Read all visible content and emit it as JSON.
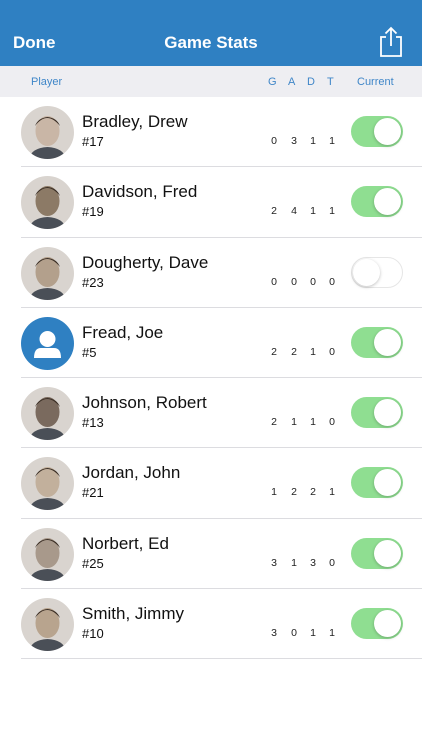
{
  "navbar": {
    "done_label": "Done",
    "title": "Game Stats",
    "share_icon": "share-icon"
  },
  "columns": {
    "player": "Player",
    "g": "G",
    "a": "A",
    "d": "D",
    "t": "T",
    "current": "Current"
  },
  "colors": {
    "nav_bg": "#2f80c2",
    "accent": "#3f86c8",
    "toggle_on": "#8fde91"
  },
  "players": [
    {
      "name": "Bradley, Drew",
      "number": "#17",
      "g": "0",
      "a": "3",
      "d": "1",
      "t": "1",
      "current": true,
      "avatar": "photo-avatar"
    },
    {
      "name": "Davidson, Fred",
      "number": "#19",
      "g": "2",
      "a": "4",
      "d": "1",
      "t": "1",
      "current": true,
      "avatar": "photo-avatar"
    },
    {
      "name": "Dougherty, Dave",
      "number": "#23",
      "g": "0",
      "a": "0",
      "d": "0",
      "t": "0",
      "current": false,
      "avatar": "photo-avatar"
    },
    {
      "name": "Fread, Joe",
      "number": "#5",
      "g": "2",
      "a": "2",
      "d": "1",
      "t": "0",
      "current": true,
      "avatar": "default-person-avatar"
    },
    {
      "name": "Johnson, Robert",
      "number": "#13",
      "g": "2",
      "a": "1",
      "d": "1",
      "t": "0",
      "current": true,
      "avatar": "photo-avatar"
    },
    {
      "name": "Jordan, John",
      "number": "#21",
      "g": "1",
      "a": "2",
      "d": "2",
      "t": "1",
      "current": true,
      "avatar": "photo-avatar"
    },
    {
      "name": "Norbert, Ed",
      "number": "#25",
      "g": "3",
      "a": "1",
      "d": "3",
      "t": "0",
      "current": true,
      "avatar": "photo-avatar"
    },
    {
      "name": "Smith, Jimmy",
      "number": "#10",
      "g": "3",
      "a": "0",
      "d": "1",
      "t": "1",
      "current": true,
      "avatar": "photo-avatar"
    }
  ]
}
